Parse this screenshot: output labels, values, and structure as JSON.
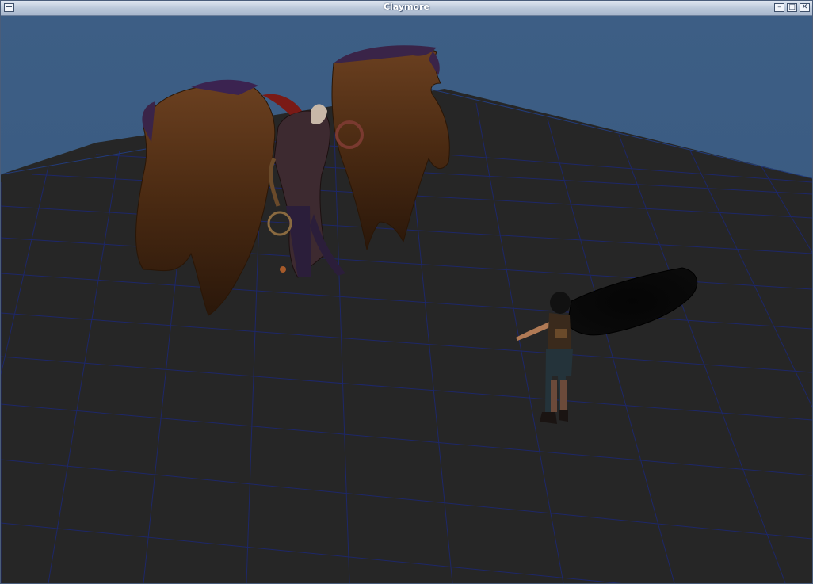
{
  "window": {
    "title": "Claymore",
    "buttons": {
      "minimize": "–",
      "maximize": "□",
      "close": "✕"
    }
  },
  "scene": {
    "sky_color": "#3a5b80",
    "floor_color": "#262626",
    "grid_color": "#1f2a6a",
    "objects": [
      "winged-demon-model",
      "female-character-model",
      "character-shadow"
    ]
  }
}
